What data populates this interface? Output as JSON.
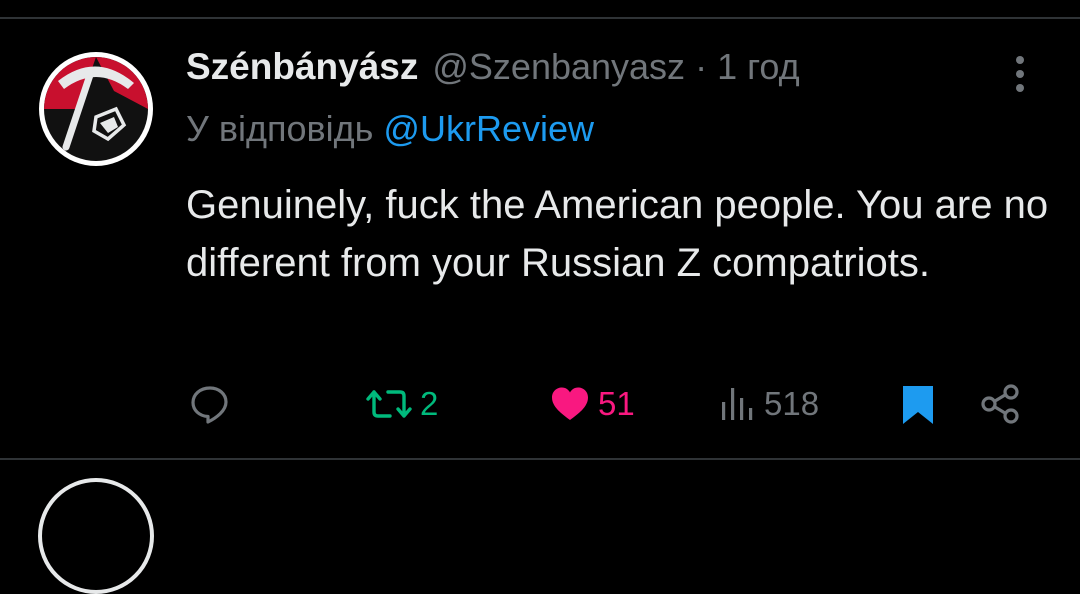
{
  "tweet": {
    "display_name": "Szénbányász",
    "handle": "@Szenbanyasz",
    "separator": "·",
    "time": "1 год",
    "reply_prefix": "У відповідь",
    "reply_to": "@UkrReview",
    "text": "Genuinely, fuck the American people. You are no different from your Russian Z compatriots.",
    "stats": {
      "retweets": "2",
      "likes": "51",
      "views": "518"
    }
  },
  "colors": {
    "background": "#000000",
    "text": "#e7e9ea",
    "muted": "#71767b",
    "link": "#1d9bf0",
    "retweet": "#00ba7c",
    "like": "#f91880",
    "bookmark": "#1d9bf0"
  },
  "icons": {
    "reply": "speech-bubble-icon",
    "retweet": "retweet-icon",
    "like": "heart-filled-icon",
    "views": "bar-chart-icon",
    "bookmark": "bookmark-filled-icon",
    "share": "share-icon",
    "more": "more-vertical-icon"
  }
}
